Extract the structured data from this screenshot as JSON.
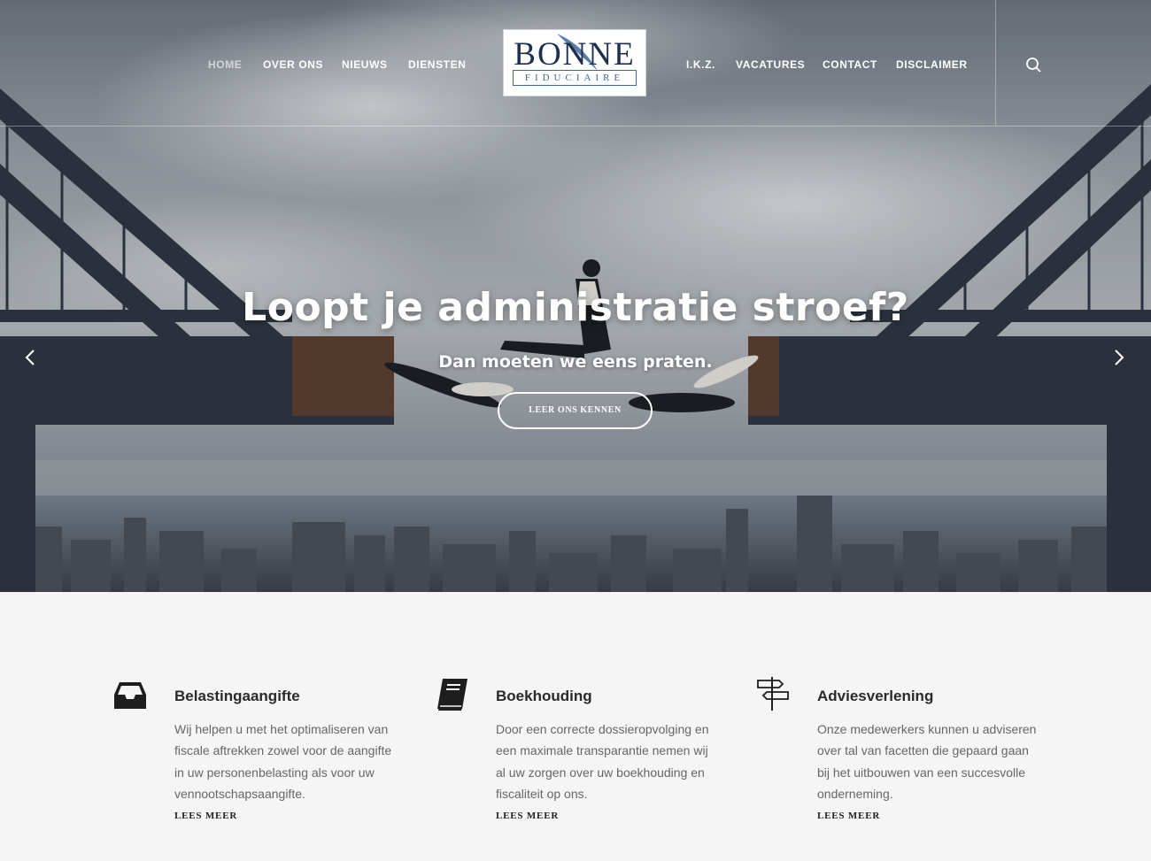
{
  "nav": {
    "left": [
      "HOME",
      "OVER ONS",
      "NIEUWS",
      "DIENSTEN"
    ],
    "right": [
      "I.K.Z.",
      "VACATURES",
      "CONTACT",
      "DISCLAIMER"
    ],
    "active": "HOME"
  },
  "logo": {
    "main": "BONNE",
    "sub": "FIDUCIAIRE"
  },
  "hero": {
    "title": "Loopt je administratie stroef?",
    "subtitle": "Dan moeten we eens praten.",
    "button": "LEER ONS KENNEN"
  },
  "services": [
    {
      "icon": "inbox-tray-icon",
      "title": "Belastingaangifte",
      "text": "Wij helpen u met het optimaliseren van fiscale aftrekken zowel voor de aangifte in uw personenbelasting als voor uw vennootschapsaangifte.",
      "more": "LEES MEER"
    },
    {
      "icon": "book-icon",
      "title": "Boekhouding",
      "text": "Door een correcte dossieropvolging en een maximale transparantie nemen wij al uw zorgen over uw boekhouding en fiscaliteit op ons.",
      "more": "LEES MEER"
    },
    {
      "icon": "signpost-icon",
      "title": "Adviesverlening",
      "text": "Onze medewerkers kunnen u adviseren over tal van facetten die gepaard gaan bij het uitbouwen van een succesvolle onderneming.",
      "more": "LEES MEER"
    }
  ],
  "colors": {
    "navy": "#1d2f4d",
    "logo_blue": "#3d6a9a",
    "services_bg": "#f5f5f5"
  }
}
